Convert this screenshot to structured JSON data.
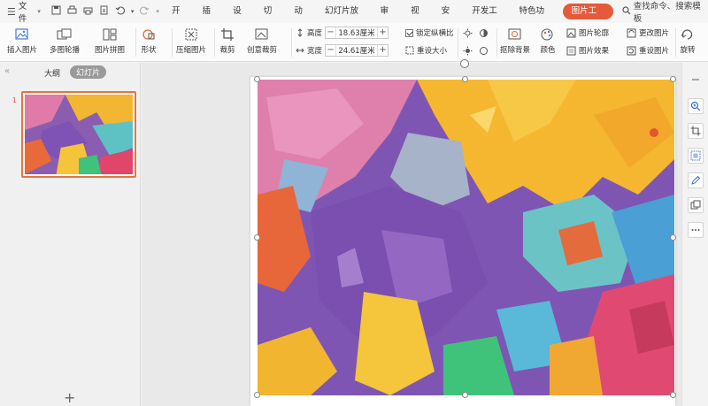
{
  "menubar": {
    "file_label": "文件",
    "tabs": [
      {
        "label": "开始"
      },
      {
        "label": "插入"
      },
      {
        "label": "设计"
      },
      {
        "label": "切换"
      },
      {
        "label": "动画"
      },
      {
        "label": "幻灯片放映"
      },
      {
        "label": "审阅"
      },
      {
        "label": "视图"
      },
      {
        "label": "安全"
      },
      {
        "label": "开发工具"
      },
      {
        "label": "特色功能"
      },
      {
        "label": "图片工具"
      }
    ],
    "active_tab": "图片工具",
    "search_label": "查找命令、搜索模板"
  },
  "ribbon": {
    "insert_picture": "插入图片",
    "multi_outline": "多图轮播",
    "picture_collage": "图片拼图",
    "shape": "形状",
    "compress": "压缩图片",
    "crop": "裁剪",
    "creative_crop": "创意裁剪",
    "height_label": "高度",
    "height_value": "18.63厘米",
    "width_label": "宽度",
    "width_value": "24.61厘米",
    "lock_ratio": "锁定纵横比",
    "reset_size": "重设大小",
    "remove_background": "抠除背景",
    "color": "颜色",
    "picture_outline": "图片轮廓",
    "picture_effects": "图片效果",
    "change_picture": "更改图片",
    "reset_picture": "重设图片",
    "rotate": "旋转"
  },
  "leftpane": {
    "outline_tab": "大纲",
    "slides_tab": "幻灯片",
    "slide_number": "1",
    "add_slide": "+"
  },
  "colors": {
    "accent": "#e45a3a",
    "thumb_border": "#e4763f"
  }
}
